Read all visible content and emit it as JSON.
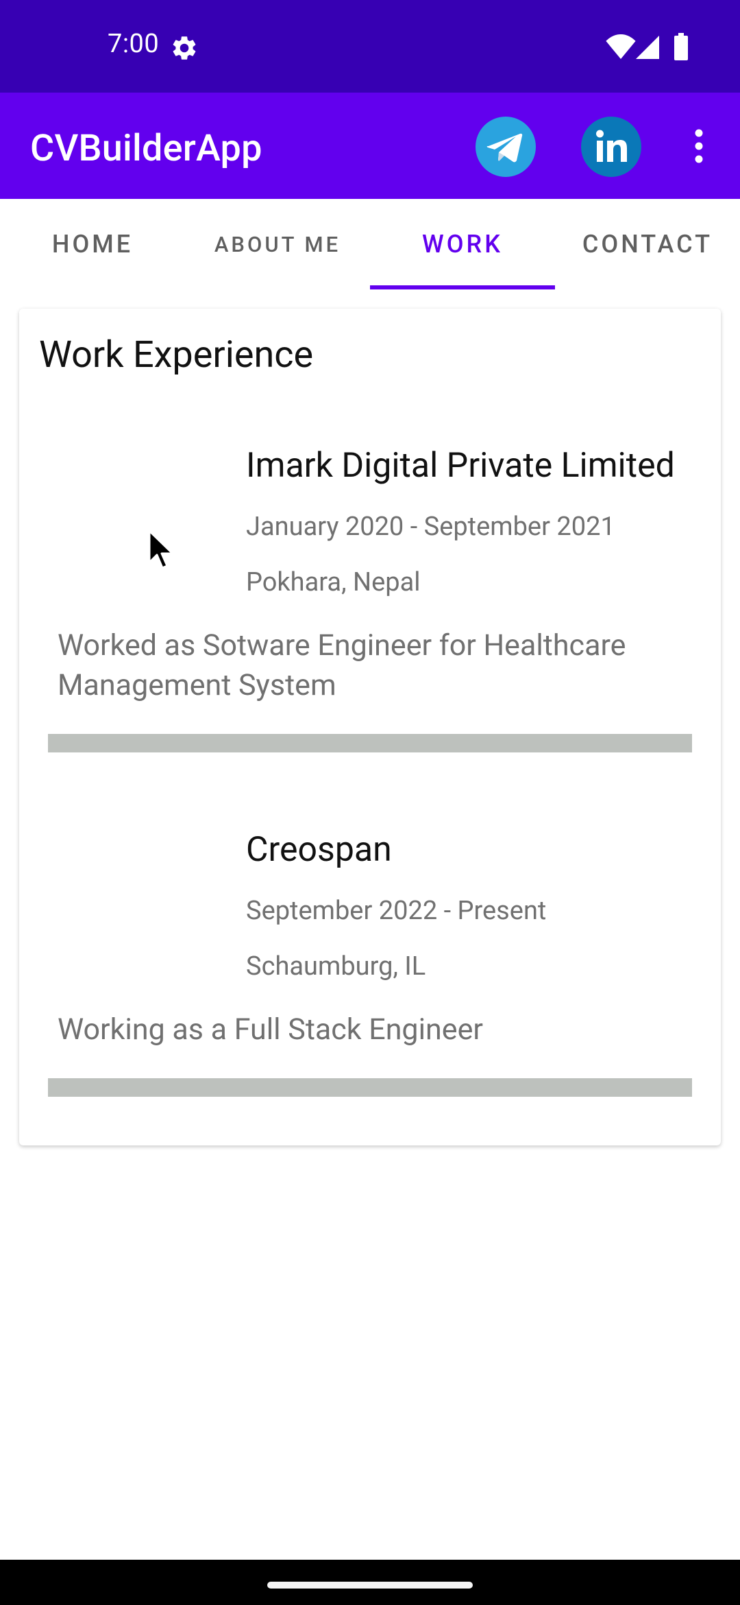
{
  "status_bar": {
    "time": "7:00",
    "icons": [
      "settings-icon",
      "wifi-icon",
      "signal-icon",
      "battery-icon"
    ]
  },
  "app_bar": {
    "title": "CVBuilderApp",
    "actions": [
      "telegram-icon",
      "linkedin-icon",
      "more-vert-icon"
    ],
    "colors": {
      "app_bar": "#6200EE",
      "status_bar": "#3700B3"
    }
  },
  "tabs": [
    {
      "label": "HOME",
      "active": false
    },
    {
      "label": "ABOUT ME",
      "active": false
    },
    {
      "label": "WORK",
      "active": true
    },
    {
      "label": "CONTACT",
      "active": false
    }
  ],
  "work": {
    "title": "Work Experience",
    "jobs": [
      {
        "company": "Imark Digital Private Limited",
        "dates": "January 2020 - September 2021",
        "location": "Pokhara, Nepal",
        "description": "Worked as Sotware Engineer for Healthcare Management System"
      },
      {
        "company": "Creospan",
        "dates": "September 2022 - Present",
        "location": "Schaumburg, IL",
        "description": "Working as a Full Stack Engineer"
      }
    ]
  }
}
